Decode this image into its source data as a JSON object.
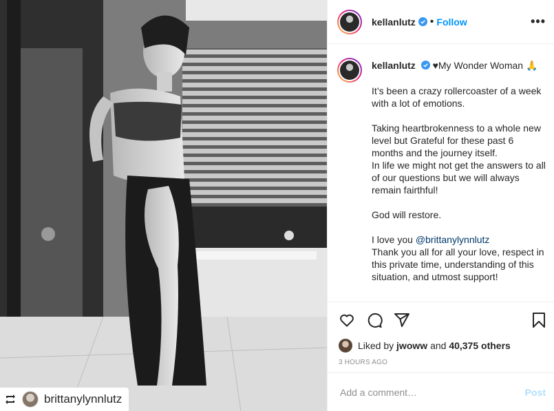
{
  "post": {
    "username": "kellanlutz",
    "follow_label": "Follow",
    "dot": "•",
    "more_label": "•••"
  },
  "caption": {
    "username": "kellanlutz",
    "title": "♥My Wonder Woman 🙏",
    "lines": [
      "It’s been a crazy rollercoaster of a week with a lot of emotions.",
      "Taking heartbrokenness to a whole new level but Grateful for these past 6 months and the journey itself.",
      "In life we might not get the answers to all of our questions but we will always remain fairthful!",
      "God will restore.",
      "I love you ",
      "@brittanylynnlutz",
      "Thank you all for all your love, respect in this private time, understanding of this situation, and utmost support!"
    ]
  },
  "likes": {
    "prefix": "Liked by ",
    "user": "jwoww",
    "middle": " and ",
    "count": "40,375 others"
  },
  "timestamp": "3 HOURS AGO",
  "comment": {
    "placeholder": "Add a comment…",
    "post_label": "Post"
  },
  "repost": {
    "icon": "repost-icon",
    "username": "brittanylynnlutz"
  },
  "icons": [
    "verified-badge-icon",
    "heart-icon",
    "comment-icon",
    "share-icon",
    "bookmark-icon"
  ],
  "colors": {
    "accent": "#0095f6",
    "verified": "#3897f0",
    "muted": "#8e8e8e",
    "post_disabled": "#b2dffc"
  }
}
